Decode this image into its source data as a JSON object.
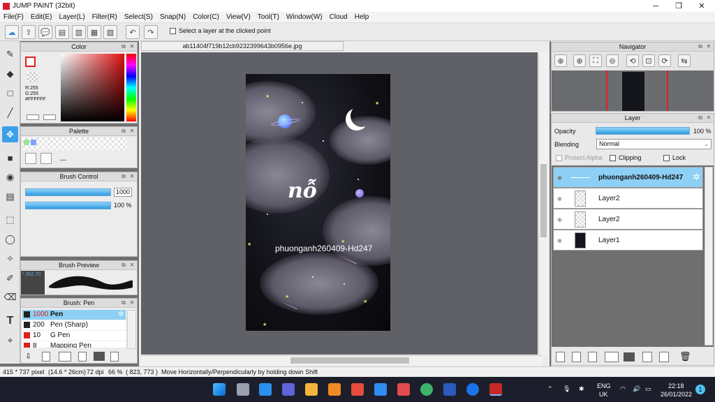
{
  "app": {
    "title": "JUMP PAINT (32bit)"
  },
  "window_controls": {
    "minimize": "─",
    "maximize": "❐",
    "close": "✕"
  },
  "menu": [
    "File(F)",
    "Edit(E)",
    "Layer(L)",
    "Filter(R)",
    "Select(S)",
    "Snap(N)",
    "Color(C)",
    "View(V)",
    "Tool(T)",
    "Window(W)",
    "Cloud",
    "Help"
  ],
  "toolbar": {
    "hint_label": "Select a layer at the clicked point"
  },
  "color_panel": {
    "title": "Color",
    "r": "R:255",
    "g": "G:255",
    "b": "B:255",
    "hex": "#FFFFFF"
  },
  "palette_panel": {
    "title": "Palette",
    "placeholder": "---"
  },
  "brush_control": {
    "title": "Brush Control",
    "size": "1000",
    "opacity": "100 %"
  },
  "brush_preview": {
    "title": "Brush Preview",
    "size_label": "* 352.70"
  },
  "brush_list": {
    "title": "Brush: Pen",
    "items": [
      {
        "size": "1000",
        "name": "Pen",
        "color": "#222222"
      },
      {
        "size": "200",
        "name": "Pen (Sharp)",
        "color": "#222222"
      },
      {
        "size": "10",
        "name": "G Pen",
        "color": "#e02020"
      },
      {
        "size": "8",
        "name": "Mapping Pen",
        "color": "#e02020"
      }
    ]
  },
  "document": {
    "tab": "ab11404f719b12cb9232399643b0956e.jpg",
    "art_text": "phuonganh260409-Hd247",
    "art_title": "nỗ"
  },
  "navigator": {
    "title": "Navigator"
  },
  "layer_panel": {
    "title": "Layer",
    "opacity_label": "Opacity",
    "opacity_value": "100 %",
    "opacity_level": 1.0,
    "blending_label": "Blending",
    "blending_value": "Normal",
    "protect_alpha": "Protect Alpha",
    "clipping": "Clipping",
    "lock": "Lock",
    "layers": [
      "phuonganh260409-Hd247",
      "Layer2",
      "Layer2",
      "Layer1"
    ]
  },
  "status": {
    "size": "415 * 737 pixel",
    "cm": "(14.6 * 26cm)",
    "dpi": "72 dpi",
    "zoom": "66 %",
    "coords": "( 823, 773 )",
    "message": "Move Horizontally/Perpendicularly by holding down Shift"
  },
  "taskbar": {
    "lang1": "ENG",
    "lang2": "UK",
    "time": "22:18",
    "date": "26/01/2022",
    "notif": "1"
  }
}
